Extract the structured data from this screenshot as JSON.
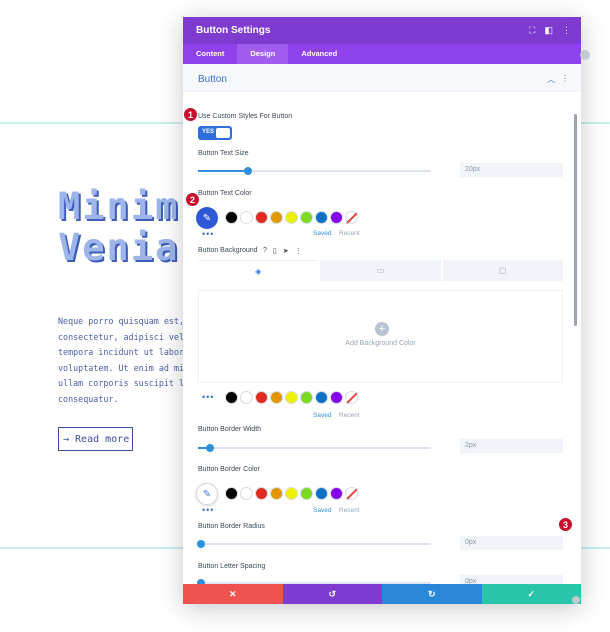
{
  "background": {
    "heading_line1": "Minim",
    "heading_line2": "Venia",
    "paragraph": "Neque porro quisquam est, qu\nconsectetur, adipisci velit,\ntempora incidunt ut labore e\nvoluptatem. Ut enim ad minim\nullam corporis suscipit labo\nconsequatur.",
    "button_label": "→ Read more"
  },
  "modal": {
    "title": "Button Settings",
    "tabs": [
      {
        "label": "Content"
      },
      {
        "label": "Design"
      },
      {
        "label": "Advanced"
      }
    ],
    "active_tab": "Design",
    "section_title": "Button",
    "use_custom_label": "Use Custom Styles For Button",
    "toggle_text": "YES",
    "text_size": {
      "label": "Button Text Size",
      "value": "20px",
      "slider_fraction": 0.2
    },
    "text_color": {
      "label": "Button Text Color",
      "saved": "Saved",
      "recent": "Recent"
    },
    "background": {
      "label": "Button Background",
      "add_label": "Add Background Color",
      "saved": "Saved",
      "recent": "Recent"
    },
    "border_width": {
      "label": "Button Border Width",
      "value": "2px",
      "slider_fraction": 0.04
    },
    "border_color": {
      "label": "Button Border Color",
      "saved": "Saved",
      "recent": "Recent"
    },
    "border_radius": {
      "label": "Button Border Radius",
      "value": "0px",
      "slider_fraction": 0.0
    },
    "letter_spacing": {
      "label": "Button Letter Spacing",
      "value": "0px",
      "slider_fraction": 0.0
    },
    "footer": {
      "cancel": "✕",
      "undo": "↺",
      "redo": "↻",
      "save": "✓"
    }
  },
  "swatch_colors": [
    "#000000",
    "#ffffff",
    "#e02b20",
    "#e09900",
    "#edf000",
    "#7cda24",
    "#0c71c3",
    "#8300e9"
  ],
  "badges": [
    "1",
    "2",
    "3"
  ],
  "colors": {
    "header": "#7e3bd0",
    "tabs_bar": "#8f42ec",
    "accent_blue": "#2e8fde",
    "cancel": "#ef5350",
    "undo": "#7e3bd0",
    "redo": "#2b87da",
    "save": "#29c4a9"
  }
}
